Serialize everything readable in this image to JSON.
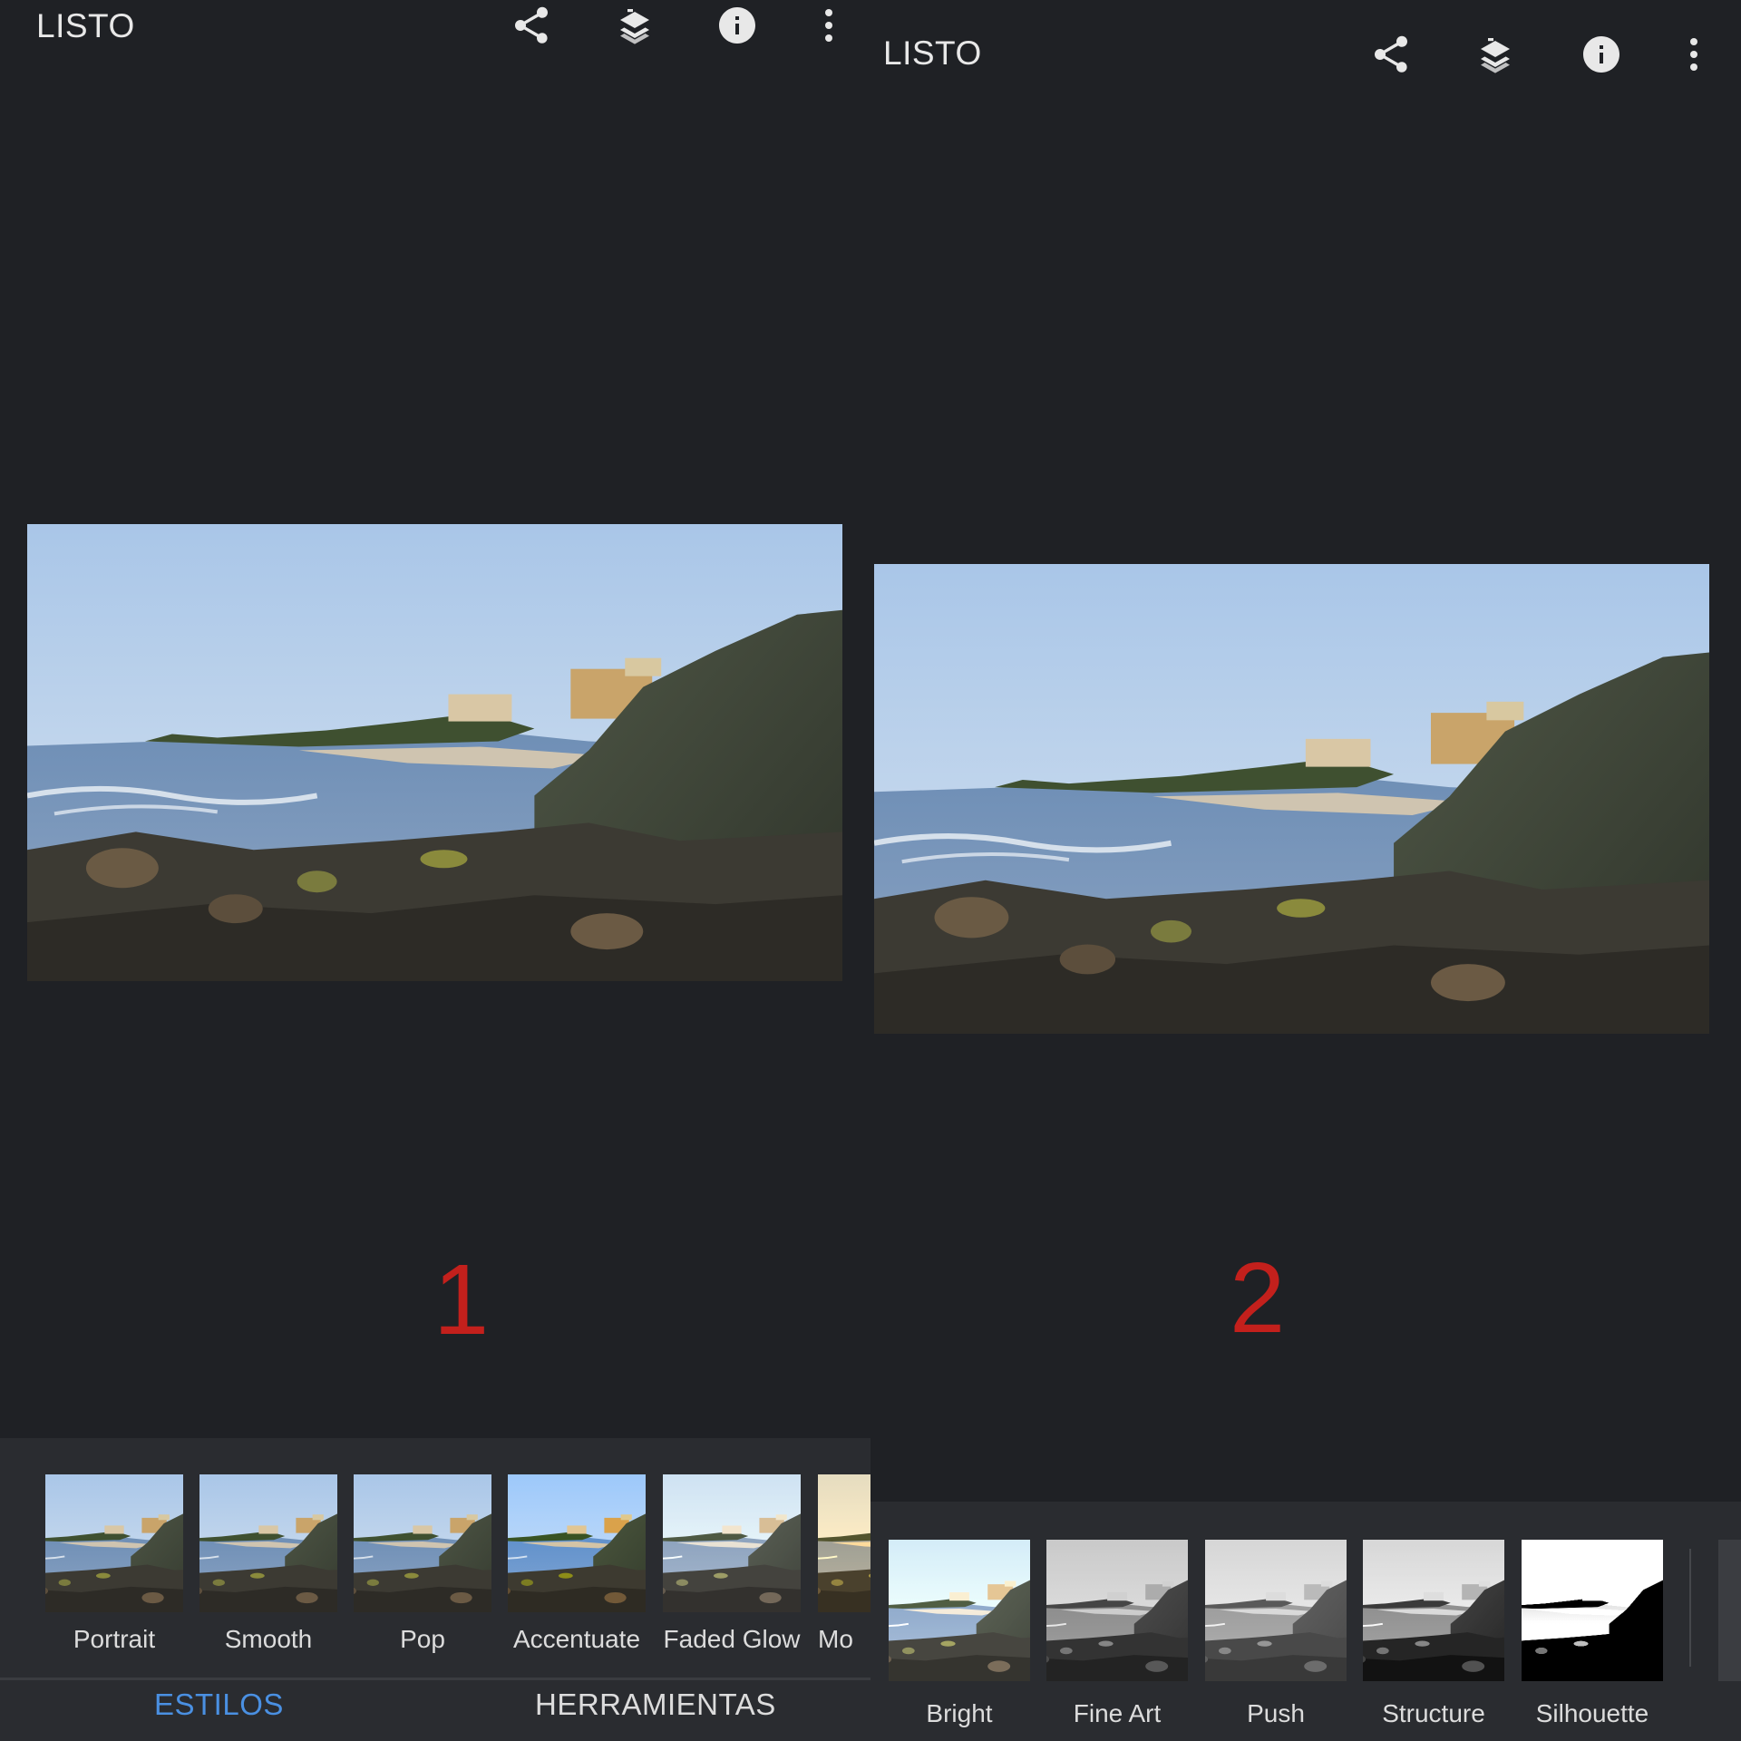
{
  "panels": [
    {
      "done_label": "LISTO",
      "marker": "1",
      "styles": [
        {
          "label": "Portrait"
        },
        {
          "label": "Smooth"
        },
        {
          "label": "Pop"
        },
        {
          "label": "Accentuate"
        },
        {
          "label": "Faded Glow"
        },
        {
          "label": "Mo"
        }
      ],
      "tabs": {
        "styles": "ESTILOS",
        "tools": "HERRAMIENTAS",
        "active": "styles"
      }
    },
    {
      "done_label": "LISTO",
      "marker": "2",
      "styles": [
        {
          "label": "Bright"
        },
        {
          "label": "Fine Art"
        },
        {
          "label": "Push"
        },
        {
          "label": "Structure"
        },
        {
          "label": "Silhouette"
        }
      ]
    }
  ],
  "icons": [
    "share-icon",
    "layers-stack-icon",
    "info-icon",
    "more-vertical-icon"
  ],
  "colors": {
    "background": "#1f2125",
    "tray": "#2a2c30",
    "accent": "#4a90e2",
    "marker": "#c3201c",
    "text": "#e6e6e6"
  }
}
